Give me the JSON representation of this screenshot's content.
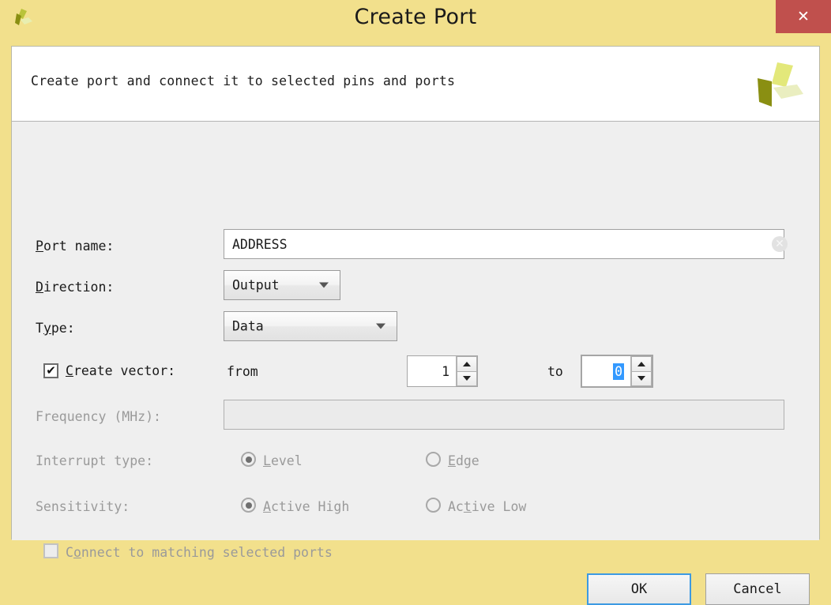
{
  "window": {
    "title": "Create Port",
    "app_icon": "vivado-pinwheel-icon",
    "close_label": "✕",
    "titlebar_color": "#f2e08c",
    "close_button_color": "#c0504d"
  },
  "banner": {
    "text": "Create port and connect it to selected pins and ports",
    "logo": "vivado-pinwheel-logo"
  },
  "form": {
    "port_name": {
      "label_pre": "P",
      "label_post": "ort name:",
      "value": "ADDRESS",
      "placeholder": "",
      "clear_icon": "clear-circle-icon"
    },
    "direction": {
      "label_pre": "D",
      "label_post": "irection:",
      "value": "Output",
      "arrow_icon": "chevron-down-icon"
    },
    "type": {
      "label_pre": "T",
      "label_mn": "y",
      "label_post": "pe:",
      "value": "Data",
      "arrow_icon": "chevron-down-icon"
    },
    "create_vector": {
      "label_pre": "C",
      "label_post": "reate vector:",
      "checked": true,
      "check_glyph": "✔",
      "from_label": "from",
      "from_value": "1",
      "to_label": "to",
      "to_value": "0",
      "up_icon": "triangle-up-icon",
      "down_icon": "triangle-down-icon"
    },
    "frequency": {
      "label": "Frequency (MHz):",
      "value": "",
      "disabled": true
    },
    "interrupt_type": {
      "label": "Interrupt type:",
      "disabled": true,
      "options": [
        {
          "label_pre": "L",
          "label_post": "evel",
          "selected": true
        },
        {
          "label_pre": "E",
          "label_post": "dge",
          "selected": false
        }
      ]
    },
    "sensitivity": {
      "label": "Sensitivity:",
      "disabled": true,
      "options": [
        {
          "label_pre": "A",
          "label_post": "ctive High",
          "selected": true
        },
        {
          "label_pre": "Ac",
          "label_mn": "t",
          "label_post": "ive Low",
          "selected": false
        }
      ]
    },
    "connect_matching": {
      "label_pre": "C",
      "label_mn": "o",
      "label_post": "nnect to matching selected ports",
      "checked": false,
      "disabled": true
    }
  },
  "buttons": {
    "ok": "OK",
    "cancel": "Cancel"
  }
}
